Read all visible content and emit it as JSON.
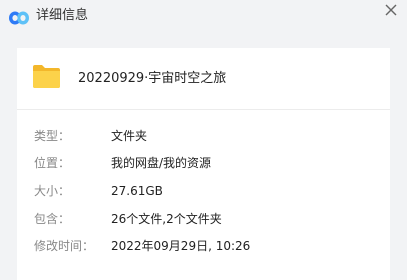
{
  "window": {
    "title": "详细信息",
    "logo_icon": "cloud-logo-icon",
    "close_icon": "close-icon"
  },
  "file": {
    "icon": "folder-icon",
    "name": "20220929·宇宙时空之旅"
  },
  "details": [
    {
      "label": "类型：",
      "value": "文件夹"
    },
    {
      "label": "位置：",
      "value": "我的网盘/我的资源"
    },
    {
      "label": "大小：",
      "value": "27.61GB"
    },
    {
      "label": "包含：",
      "value": "26个文件,2个文件夹"
    },
    {
      "label": "修改时间：",
      "value": "2022年09月29日, 10:26"
    }
  ],
  "colors": {
    "background": "#f2f3f5",
    "card": "#ffffff",
    "folder": "#f9c93a",
    "logo_left": "#2f7bf6",
    "logo_right": "#5ec1f7"
  }
}
